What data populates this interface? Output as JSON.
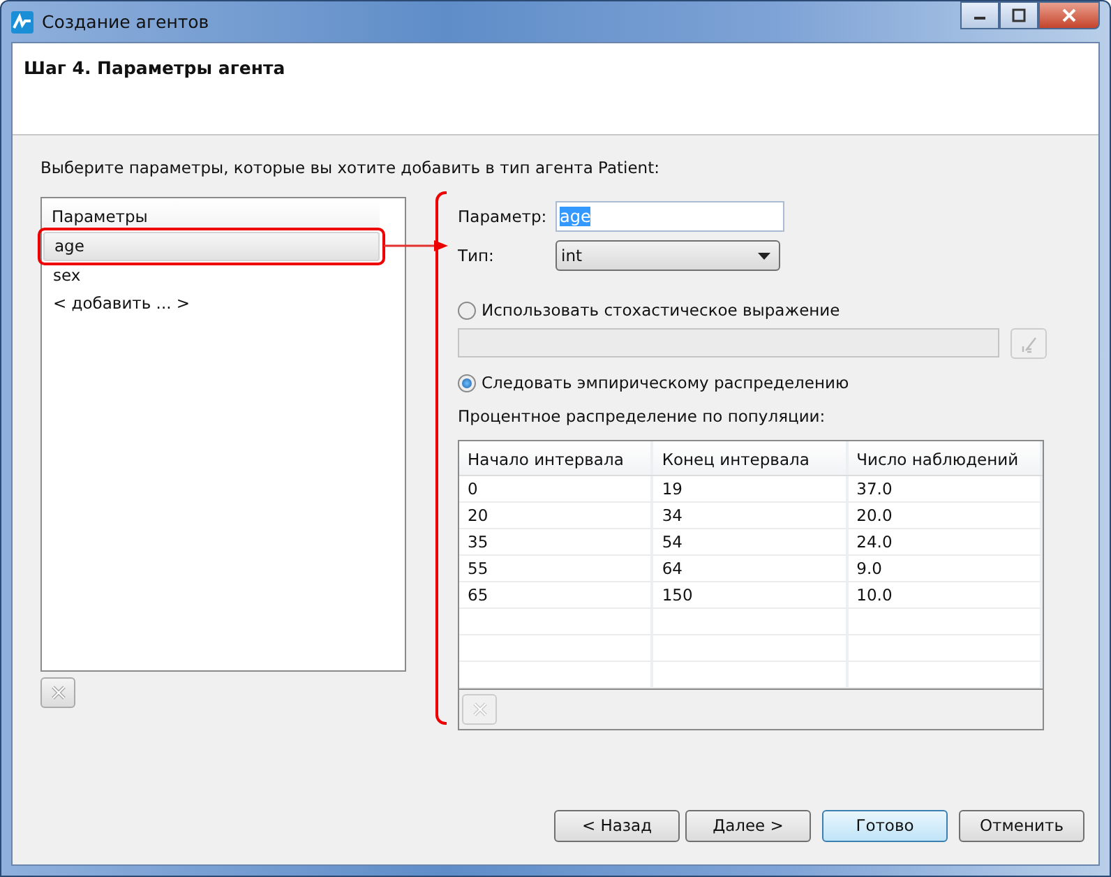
{
  "window": {
    "title": "Создание агентов"
  },
  "header": {
    "title": "Шаг 4. Параметры агента"
  },
  "instruction": "Выберите параметры, которые вы хотите добавить в тип агента Patient:",
  "parameters_list": {
    "heading": "Параметры",
    "items": [
      {
        "label": "age",
        "selected": true
      },
      {
        "label": "sex",
        "selected": false
      },
      {
        "label": "< добавить ... >",
        "selected": false
      }
    ]
  },
  "parameter": {
    "label": "Параметр:",
    "value": "age"
  },
  "type": {
    "label": "Тип:",
    "value": "int"
  },
  "options": [
    {
      "label": "Использовать стохастическое выражение",
      "selected": false
    },
    {
      "label": "Следовать эмпирическому распределению",
      "selected": true
    }
  ],
  "distribution": {
    "label": "Процентное распределение по популяции:",
    "columns": [
      "Начало интервала",
      "Конец интервала",
      "Число наблюдений"
    ],
    "rows": [
      [
        "0",
        "19",
        "37.0"
      ],
      [
        "20",
        "34",
        "20.0"
      ],
      [
        "35",
        "54",
        "24.0"
      ],
      [
        "55",
        "64",
        "9.0"
      ],
      [
        "65",
        "150",
        "10.0"
      ]
    ]
  },
  "buttons": [
    {
      "label": "< Назад",
      "default": false
    },
    {
      "label": "Далее >",
      "default": false
    },
    {
      "label": "Готово",
      "default": true
    },
    {
      "label": "Отменить",
      "default": false
    }
  ]
}
